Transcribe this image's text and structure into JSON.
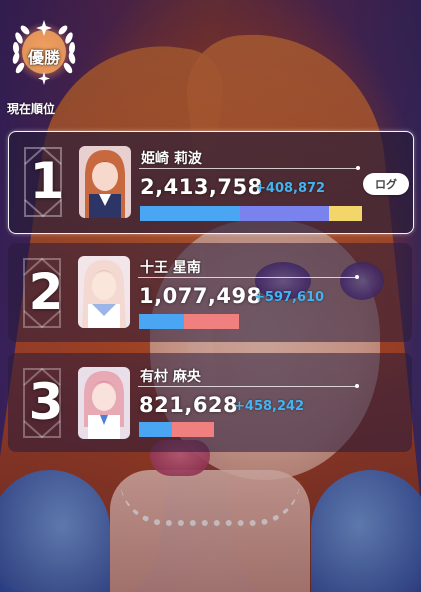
{
  "header": {
    "badge_label": "優勝",
    "current_rank_label": "現在順位"
  },
  "colors": {
    "gain_blue": "#43b4f1",
    "bar_blue": "#4aa6f2",
    "bar_purple": "#7a82ee",
    "bar_yellow": "#f2d66a",
    "bar_pink": "#f08080",
    "card_border": "#ffffff"
  },
  "rankings": [
    {
      "rank": "1",
      "name": "姫崎 莉波",
      "score": "2,413,758",
      "gain": "+408,872",
      "log_label": "ログ",
      "bar": {
        "total_fraction": 1.0,
        "segments": [
          {
            "color": "#4aa6f2",
            "fraction": 0.45
          },
          {
            "color": "#7a82ee",
            "fraction": 0.4
          },
          {
            "color": "#f2d66a",
            "fraction": 0.15
          }
        ]
      }
    },
    {
      "rank": "2",
      "name": "十王 星南",
      "score": "1,077,498",
      "gain": "+597,610",
      "bar": {
        "total_fraction": 0.45,
        "segments": [
          {
            "color": "#4aa6f2",
            "fraction": 0.45
          },
          {
            "color": "#f08080",
            "fraction": 0.55
          }
        ]
      }
    },
    {
      "rank": "3",
      "name": "有村 麻央",
      "score": "821,628",
      "gain": "+458,242",
      "bar": {
        "total_fraction": 0.34,
        "segments": [
          {
            "color": "#4aa6f2",
            "fraction": 0.44
          },
          {
            "color": "#f08080",
            "fraction": 0.56
          }
        ]
      }
    }
  ]
}
